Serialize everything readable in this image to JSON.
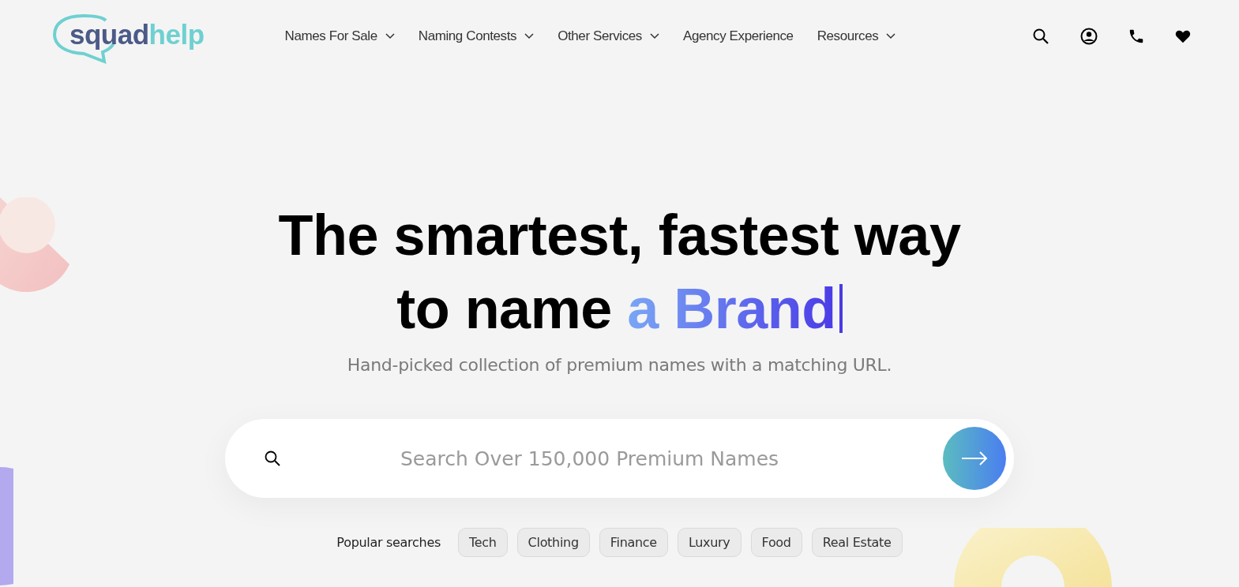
{
  "logo": {
    "first": "squad",
    "second": "help"
  },
  "nav": [
    {
      "label": "Names For Sale",
      "dropdown": true
    },
    {
      "label": "Naming Contests",
      "dropdown": true
    },
    {
      "label": "Other Services",
      "dropdown": true
    },
    {
      "label": "Agency Experience",
      "dropdown": false
    },
    {
      "label": "Resources",
      "dropdown": true
    }
  ],
  "hero": {
    "heading_line_1": "The smartest, fastest way",
    "heading_line_2": "to name ",
    "heading_highlight": "a Brand",
    "subtitle": "Hand-picked collection of premium names with a matching URL."
  },
  "search": {
    "placeholder": "Search Over 150,000 Premium Names"
  },
  "popular": {
    "label": "Popular searches",
    "tags": [
      "Tech",
      "Clothing",
      "Finance",
      "Luxury",
      "Food",
      "Real Estate"
    ]
  }
}
